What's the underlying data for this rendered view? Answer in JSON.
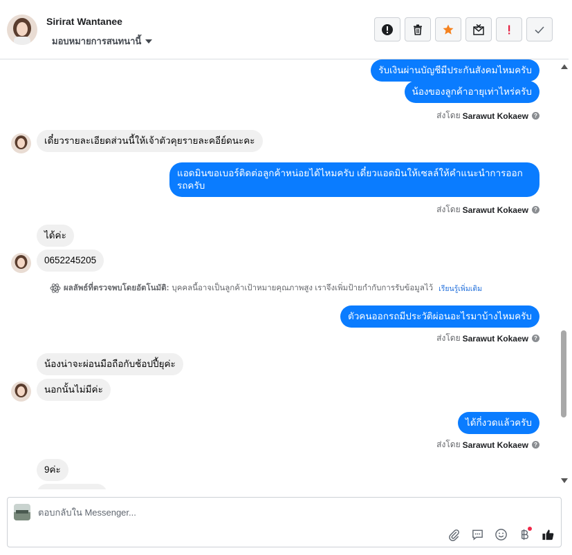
{
  "header": {
    "contact_name": "Sirirat Wantanee",
    "assign_label": "มอบหมายการสนทนานี้"
  },
  "toolbar": {
    "buttons": [
      {
        "name": "spam-alert",
        "icon": "alert-circle-icon"
      },
      {
        "name": "delete",
        "icon": "trash-icon"
      },
      {
        "name": "star",
        "icon": "star-icon",
        "color": "#f5821f"
      },
      {
        "name": "mark-unread",
        "icon": "envelope-x-icon"
      },
      {
        "name": "important",
        "icon": "exclamation-icon",
        "color": "#e41e3f"
      },
      {
        "name": "done",
        "icon": "check-icon"
      }
    ]
  },
  "thread": {
    "messages": [
      {
        "dir": "out",
        "text": "รับเงินผ่านบัญชีมีประกันสังคมไหมครับ"
      },
      {
        "dir": "out",
        "text": "น้องของลูกค้าอายุเท่าไหร่ครับ"
      },
      {
        "dir": "in",
        "text": "เดี๋ยวรายละเอียดส่วนนี้ให้เจ้าตัวคุยรายละคอีย์ดนะคะ"
      },
      {
        "dir": "out",
        "text": "แอดมินขอเบอร์ติดต่อลูกค้าหน่อยได้ไหมครับ เดี๋ยวแอดมินให้เซลล์ให้คำแนะนำการออกรถครับ"
      },
      {
        "dir": "in",
        "text": "ได้ค่ะ"
      },
      {
        "dir": "in",
        "text": "0652245205"
      },
      {
        "dir": "out",
        "text": "ตัวคนออกรถมีประวัติผ่อนอะไรมาบ้างไหมครับ"
      },
      {
        "dir": "in",
        "text": "น้องน่าจะผ่อนมือถือกับช้อปปี้ยุค่ะ"
      },
      {
        "dir": "in",
        "text": "นอกนั้นไม่มีค่ะ"
      },
      {
        "dir": "out",
        "text": "ได้กี่งวดแล้วครับ"
      },
      {
        "dir": "in",
        "text": "9ค่ะ"
      }
    ],
    "sent_by_prefix": "ส่งโดย",
    "sent_by_name": "Sarawut Kokaew",
    "auto_detect": {
      "label": "ผลลัพธ์ที่ตรวจพบโดยอัตโนมัติ:",
      "text": "บุคคลนี้อาจเป็นลูกค้าเป้าหมายคุณภาพสูง เราจึงเพิ่มป้ายกำกับการรับข้อมูลไว้",
      "learn_more": "เรียนรู้เพิ่มเติม"
    }
  },
  "composer": {
    "placeholder": "ตอบกลับใน Messenger...",
    "tools": [
      "paperclip-icon",
      "chat-bubble-icon",
      "smiley-icon",
      "baht-icon",
      "thumbs-up-icon"
    ]
  },
  "colors": {
    "outgoing_bubble": "#0a7cff",
    "incoming_bubble": "#f0f0f0"
  }
}
